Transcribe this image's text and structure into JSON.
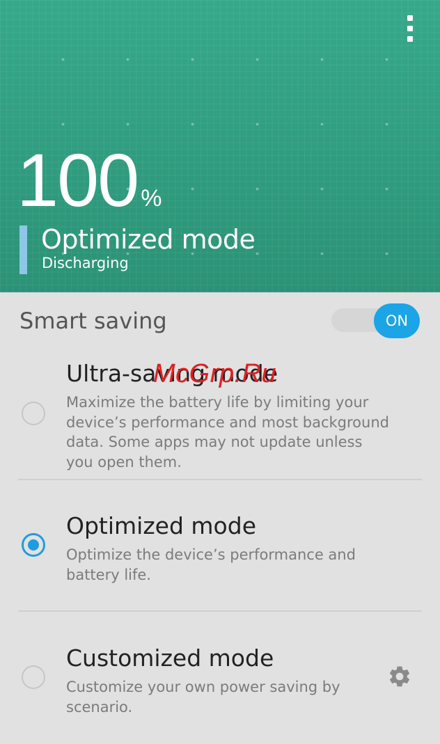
{
  "header": {
    "battery_level": "100",
    "percent_sign": "%",
    "mode_title": "Optimized mode",
    "status": "Discharging",
    "menu_icon": "more-vert-icon"
  },
  "smart_saving": {
    "label": "Smart saving",
    "toggle_label": "ON",
    "toggle_state": true
  },
  "options": [
    {
      "title": "Ultra-saving mode",
      "description": "Maximize the battery life by limiting your device’s performance and most background data. Some apps may not update unless you open them.",
      "selected": false
    },
    {
      "title": "Optimized mode",
      "description": "Optimize the device’s performance and battery life.",
      "selected": true
    },
    {
      "title": "Customized mode",
      "description": "Customize your own power saving by scenario.",
      "selected": false,
      "settings_icon": "gear-icon"
    }
  ],
  "watermark": "McGrp.Ru",
  "colors": {
    "header_green": "#2f9c7e",
    "accent_blue": "#1ba4e6",
    "mode_bar": "#8ec7e6",
    "background": "#e1e1e1"
  }
}
